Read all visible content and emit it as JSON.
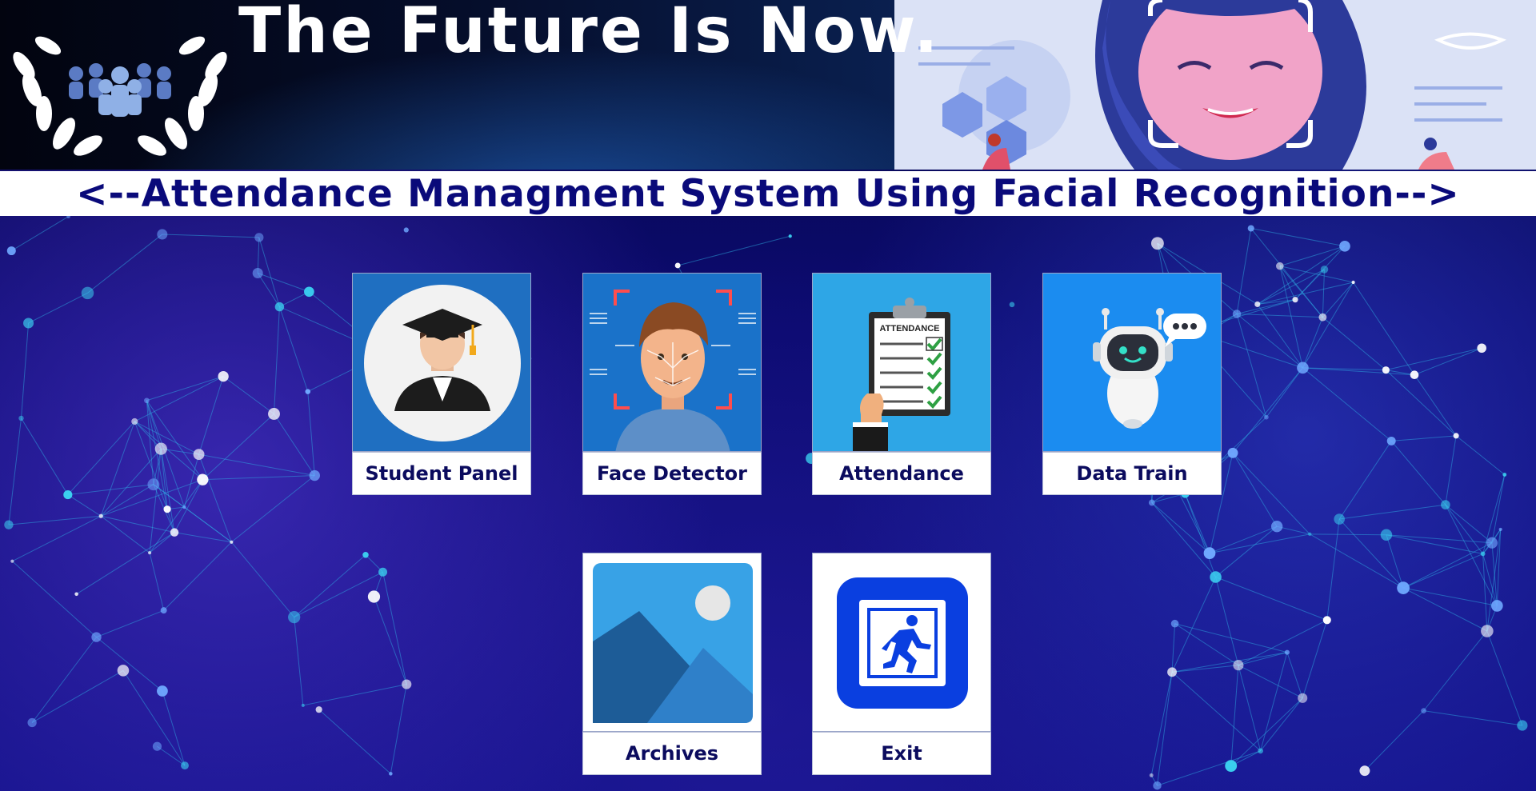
{
  "header": {
    "tagline": "The Future Is Now."
  },
  "system_title": "<--Attendance Managment System Using Facial Recognition-->",
  "tiles": [
    {
      "label": "Student Panel",
      "icon": "graduate-icon"
    },
    {
      "label": "Face Detector",
      "icon": "face-scan-icon"
    },
    {
      "label": "Attendance",
      "icon": "attendance-clipboard-icon"
    },
    {
      "label": "Data Train",
      "icon": "robot-icon"
    },
    {
      "label": "Archives",
      "icon": "image-gallery-icon"
    },
    {
      "label": "Exit",
      "icon": "exit-door-icon"
    }
  ],
  "images": {
    "attendance_sheet_text": "ATTENDANCE"
  },
  "colors": {
    "title_text": "#0a0a7a",
    "tile_label_text": "#0b0b5e",
    "background": "#0b0a6e"
  }
}
